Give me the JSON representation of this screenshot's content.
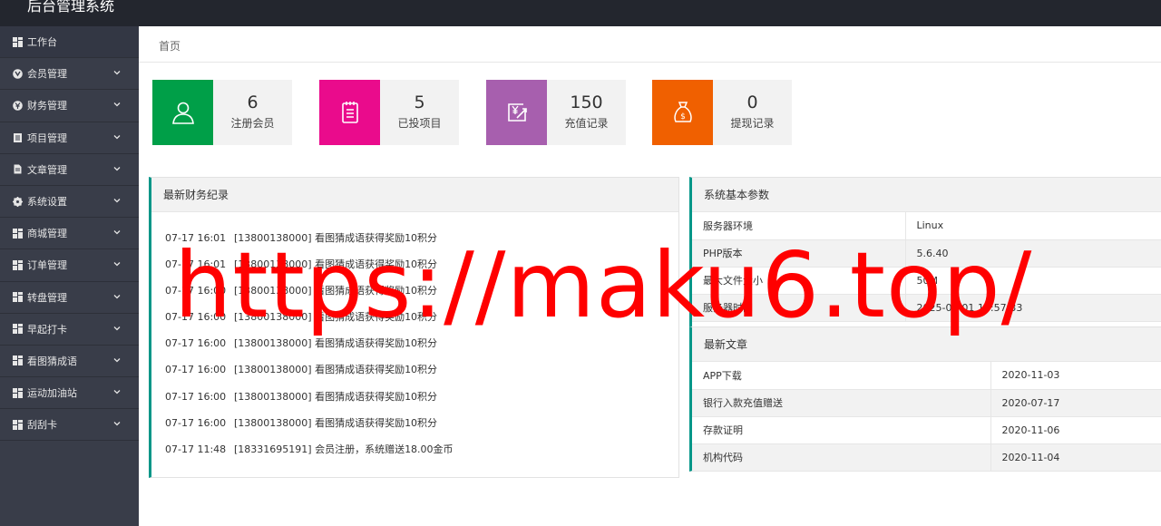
{
  "header": {
    "title": "后台管理系统"
  },
  "sidebar": {
    "items": [
      {
        "label": "工作台",
        "icon": "dashboard-icon",
        "has_chevron": false
      },
      {
        "label": "会员管理",
        "icon": "member-icon",
        "has_chevron": true
      },
      {
        "label": "财务管理",
        "icon": "finance-icon",
        "has_chevron": true
      },
      {
        "label": "项目管理",
        "icon": "project-icon",
        "has_chevron": true
      },
      {
        "label": "文章管理",
        "icon": "article-icon",
        "has_chevron": true
      },
      {
        "label": "系统设置",
        "icon": "gear-icon",
        "has_chevron": true
      },
      {
        "label": "商城管理",
        "icon": "grid-icon",
        "has_chevron": true
      },
      {
        "label": "订单管理",
        "icon": "grid-icon",
        "has_chevron": true
      },
      {
        "label": "转盘管理",
        "icon": "grid-icon",
        "has_chevron": true
      },
      {
        "label": "早起打卡",
        "icon": "grid-icon",
        "has_chevron": true
      },
      {
        "label": "看图猜成语",
        "icon": "grid-icon",
        "has_chevron": true
      },
      {
        "label": "运动加油站",
        "icon": "grid-icon",
        "has_chevron": true
      },
      {
        "label": "刮刮卡",
        "icon": "grid-icon",
        "has_chevron": true
      }
    ]
  },
  "breadcrumb": {
    "label": "首页"
  },
  "stats": [
    {
      "value": "6",
      "label": "注册会员",
      "color": "#009f48",
      "icon": "user-icon"
    },
    {
      "value": "5",
      "label": "已投项目",
      "color": "#ea0b8c",
      "icon": "clipboard-icon"
    },
    {
      "value": "150",
      "label": "充值记录",
      "color": "#a75fae",
      "icon": "recharge-icon"
    },
    {
      "value": "0",
      "label": "提现记录",
      "color": "#f06000",
      "icon": "money-bag-icon"
    }
  ],
  "finance": {
    "title": "最新财务纪录",
    "rows": [
      {
        "time": "07-17 16:01",
        "text": "[13800138000] 看图猜成语获得奖励10积分"
      },
      {
        "time": "07-17 16:01",
        "text": "[13800138000] 看图猜成语获得奖励10积分"
      },
      {
        "time": "07-17 16:00",
        "text": "[13800138000] 看图猜成语获得奖励10积分"
      },
      {
        "time": "07-17 16:00",
        "text": "[13800138000] 看图猜成语获得奖励10积分"
      },
      {
        "time": "07-17 16:00",
        "text": "[13800138000] 看图猜成语获得奖励10积分"
      },
      {
        "time": "07-17 16:00",
        "text": "[13800138000] 看图猜成语获得奖励10积分"
      },
      {
        "time": "07-17 16:00",
        "text": "[13800138000] 看图猜成语获得奖励10积分"
      },
      {
        "time": "07-17 16:00",
        "text": "[13800138000] 看图猜成语获得奖励10积分"
      },
      {
        "time": "07-17 11:48",
        "text": "[18331695191] 会员注册，系统赠送18.00金币"
      }
    ]
  },
  "system": {
    "title": "系统基本参数",
    "rows": [
      {
        "key": "服务器环境",
        "value": "Linux"
      },
      {
        "key": "PHP版本",
        "value": "5.6.40"
      },
      {
        "key": "最大文件大小",
        "value": "50M"
      },
      {
        "key": "服务器时间",
        "value": "2025-02-01 18:57:33"
      }
    ]
  },
  "articles": {
    "title": "最新文章",
    "rows": [
      {
        "name": "APP下载",
        "date": "2020-11-03"
      },
      {
        "name": "银行入款充值赠送",
        "date": "2020-07-17"
      },
      {
        "name": "存款证明",
        "date": "2020-11-06"
      },
      {
        "name": "机构代码",
        "date": "2020-11-04"
      }
    ]
  },
  "watermark": {
    "text": "https://maku6.top/"
  }
}
